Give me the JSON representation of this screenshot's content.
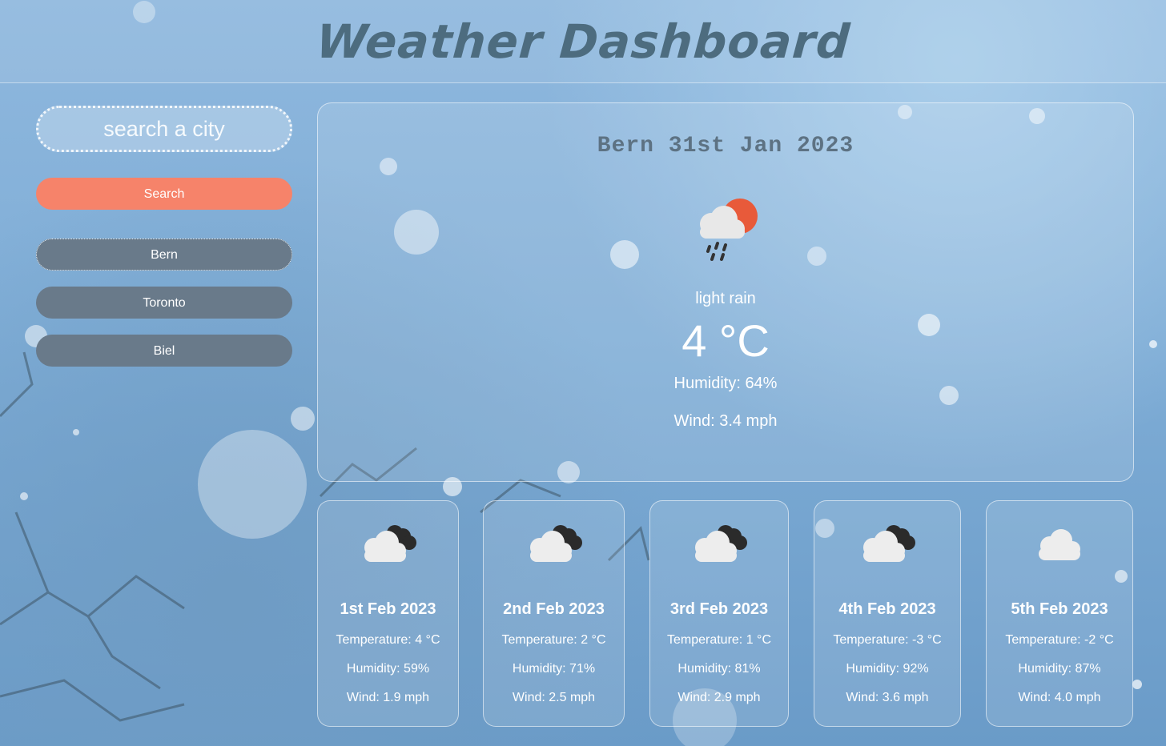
{
  "header": {
    "title": "Weather Dashboard"
  },
  "sidebar": {
    "search_placeholder": "search a city",
    "search_label": "Search",
    "history": [
      "Bern",
      "Toronto",
      "Biel"
    ]
  },
  "current": {
    "title": "Bern 31st Jan 2023",
    "icon": "light-rain-sun-icon",
    "description": "light rain",
    "temperature": "4 °C",
    "humidity": "Humidity: 64%",
    "wind": "Wind: 3.4 mph"
  },
  "forecast": [
    {
      "date": "1st Feb 2023",
      "icon": "dark-clouds-icon",
      "temperature": "Temperature: 4 °C",
      "humidity": "Humidity: 59%",
      "wind": "Wind: 1.9 mph"
    },
    {
      "date": "2nd Feb 2023",
      "icon": "dark-clouds-icon",
      "temperature": "Temperature: 2 °C",
      "humidity": "Humidity: 71%",
      "wind": "Wind: 2.5 mph"
    },
    {
      "date": "3rd Feb 2023",
      "icon": "dark-clouds-icon",
      "temperature": "Temperature: 1 °C",
      "humidity": "Humidity: 81%",
      "wind": "Wind: 2.9 mph"
    },
    {
      "date": "4th Feb 2023",
      "icon": "dark-clouds-icon",
      "temperature": "Temperature: -3 °C",
      "humidity": "Humidity: 92%",
      "wind": "Wind: 3.6 mph"
    },
    {
      "date": "5th Feb 2023",
      "icon": "cloud-icon",
      "temperature": "Temperature: -2 °C",
      "humidity": "Humidity: 87%",
      "wind": "Wind: 4.0 mph"
    }
  ],
  "colors": {
    "accent": "#f6836a",
    "history_button": "#697a8a",
    "title": "#4d6c7f"
  }
}
